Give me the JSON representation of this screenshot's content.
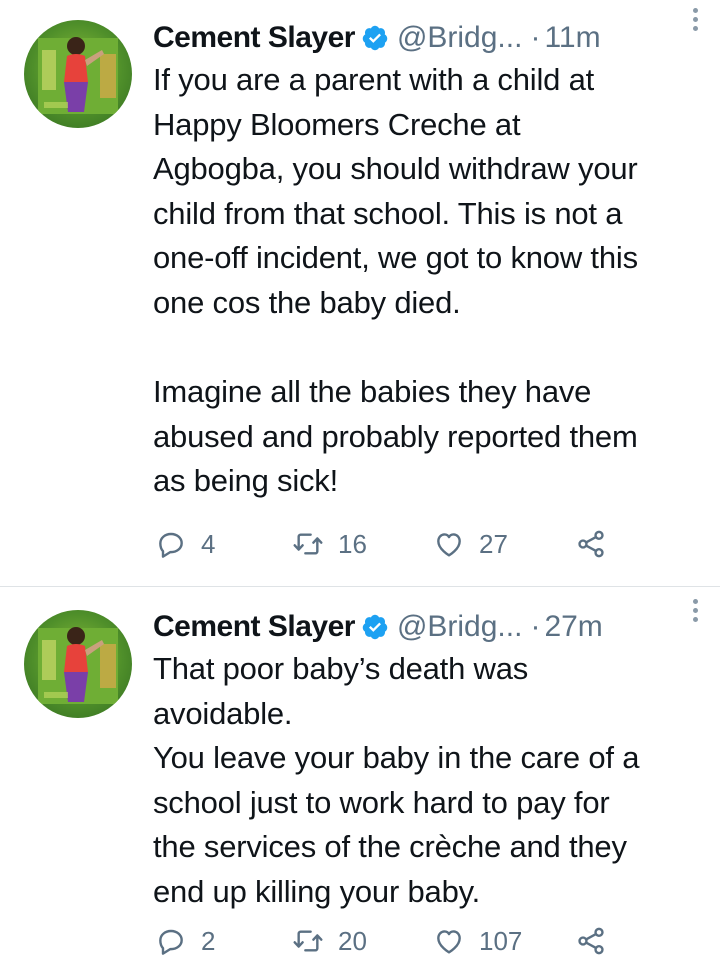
{
  "tweets": [
    {
      "author": {
        "name": "Cement Slayer",
        "handle": "@Bridg...",
        "verified": true,
        "avatar_icon": "profile-photo"
      },
      "time": "11m",
      "separator": "·",
      "text": "If you are a parent with a child at\nHappy Bloomers Creche at\nAgbogba, you should withdraw your\nchild from that school. This is not a\none-off incident, we got to know this\none cos the baby died.\n\nImagine all the babies they have\nabused and probably reported them\nas being sick!",
      "replies": "4",
      "retweets": "16",
      "likes": "27"
    },
    {
      "author": {
        "name": "Cement Slayer",
        "handle": "@Bridg...",
        "verified": true,
        "avatar_icon": "profile-photo"
      },
      "time": "27m",
      "separator": "·",
      "text": "That poor baby’s death was\navoidable.\nYou leave your baby in the care of a\nschool just to work hard to pay for\nthe services of the crèche and they\nend up killing your baby.",
      "replies": "2",
      "retweets": "20",
      "likes": "107"
    }
  ],
  "colors": {
    "text": "#0f1419",
    "secondary": "#5b7083",
    "verified": "#1da1f2",
    "divider": "#dfe3e6"
  }
}
